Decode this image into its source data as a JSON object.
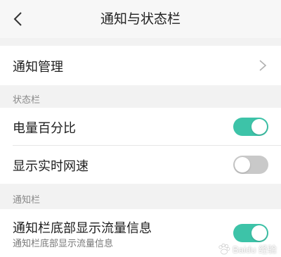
{
  "header": {
    "title": "通知与状态栏",
    "back_icon": "chevron-left-icon"
  },
  "rows": {
    "notification_management": {
      "label": "通知管理",
      "icon": "chevron-right-icon"
    },
    "battery_percentage": {
      "label": "电量百分比",
      "enabled": true
    },
    "realtime_speed": {
      "label": "显示实时网速",
      "enabled": false
    },
    "traffic_info": {
      "label": "通知栏底部显示流量信息",
      "sublabel": "通知栏底部显示流量信息",
      "enabled": true
    }
  },
  "sections": {
    "status_bar": "状态栏",
    "notification_bar": "通知栏"
  },
  "colors": {
    "toggle_on": "#3dc3a8",
    "toggle_off": "#c9c9c9"
  },
  "watermark": {
    "text": "Baidu 经验"
  }
}
